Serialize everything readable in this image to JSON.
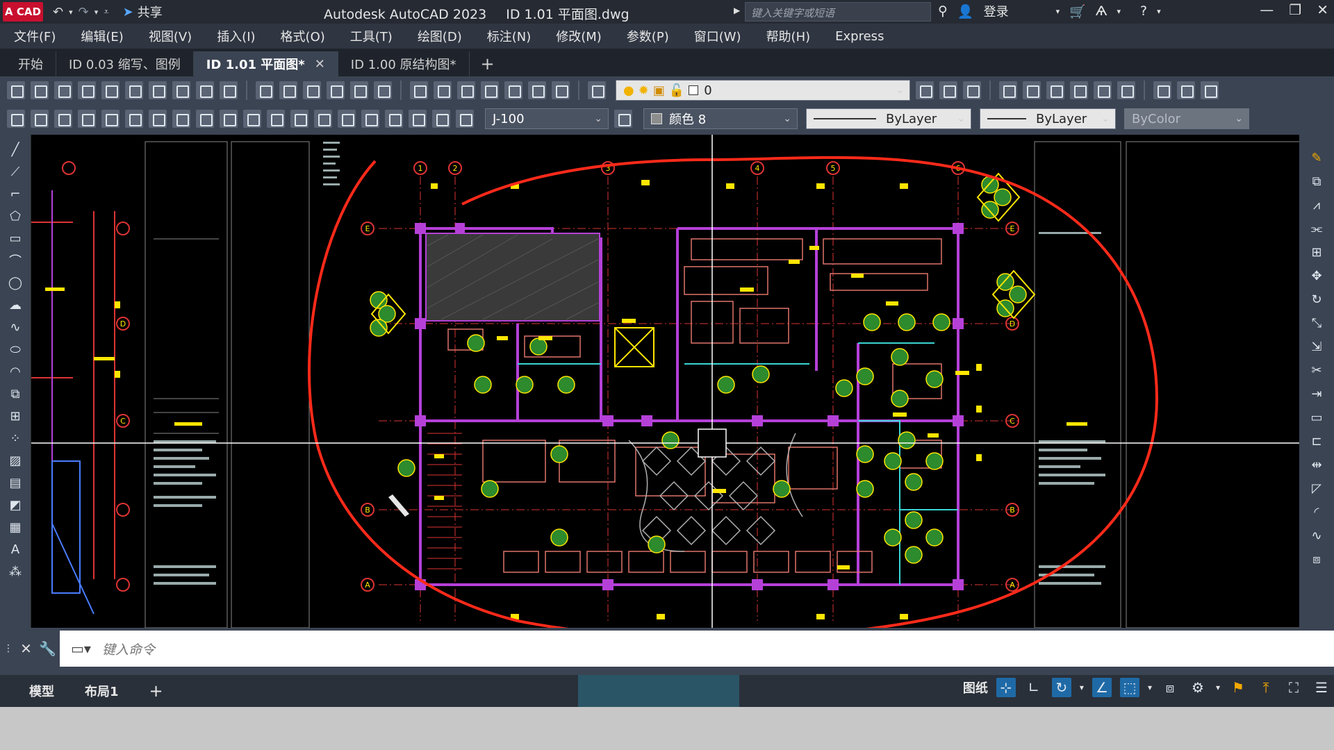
{
  "app": {
    "logo": "A CAD",
    "share": "共享",
    "title_app": "Autodesk AutoCAD 2023",
    "title_file": "ID 1.01 平面图.dwg",
    "search_placeholder": "键入关键字或短语",
    "login": "登录"
  },
  "menu": [
    "文件(F)",
    "编辑(E)",
    "视图(V)",
    "插入(I)",
    "格式(O)",
    "工具(T)",
    "绘图(D)",
    "标注(N)",
    "修改(M)",
    "参数(P)",
    "窗口(W)",
    "帮助(H)",
    "Express"
  ],
  "tabs": [
    {
      "label": "开始",
      "active": false
    },
    {
      "label": "ID 0.03 缩写、图例",
      "active": false
    },
    {
      "label": "ID 1.01 平面图*",
      "active": true
    },
    {
      "label": "ID 1.00 原结构图*",
      "active": false
    }
  ],
  "toolbar": {
    "layer_value": "0",
    "dimstyle_value": "J-100",
    "color_value": "颜色 8",
    "linetype_value": "ByLayer",
    "lineweight_value": "ByLayer",
    "plotstyle_value": "ByColor"
  },
  "command": {
    "placeholder": "键入命令"
  },
  "layout_tabs": [
    "模型",
    "布局1"
  ],
  "status": {
    "paper": "图纸"
  },
  "drawing": {
    "grid_numbers": [
      "1",
      "2",
      "3",
      "4",
      "5",
      "6"
    ],
    "grid_letters": [
      "E",
      "D",
      "C",
      "B",
      "A"
    ]
  },
  "colors": {
    "annotation_red": "#ff2a1a",
    "wall_purple": "#b540d8",
    "yellow": "#ffe600",
    "green": "#3ad14a",
    "crosshair": "#ffffff"
  }
}
